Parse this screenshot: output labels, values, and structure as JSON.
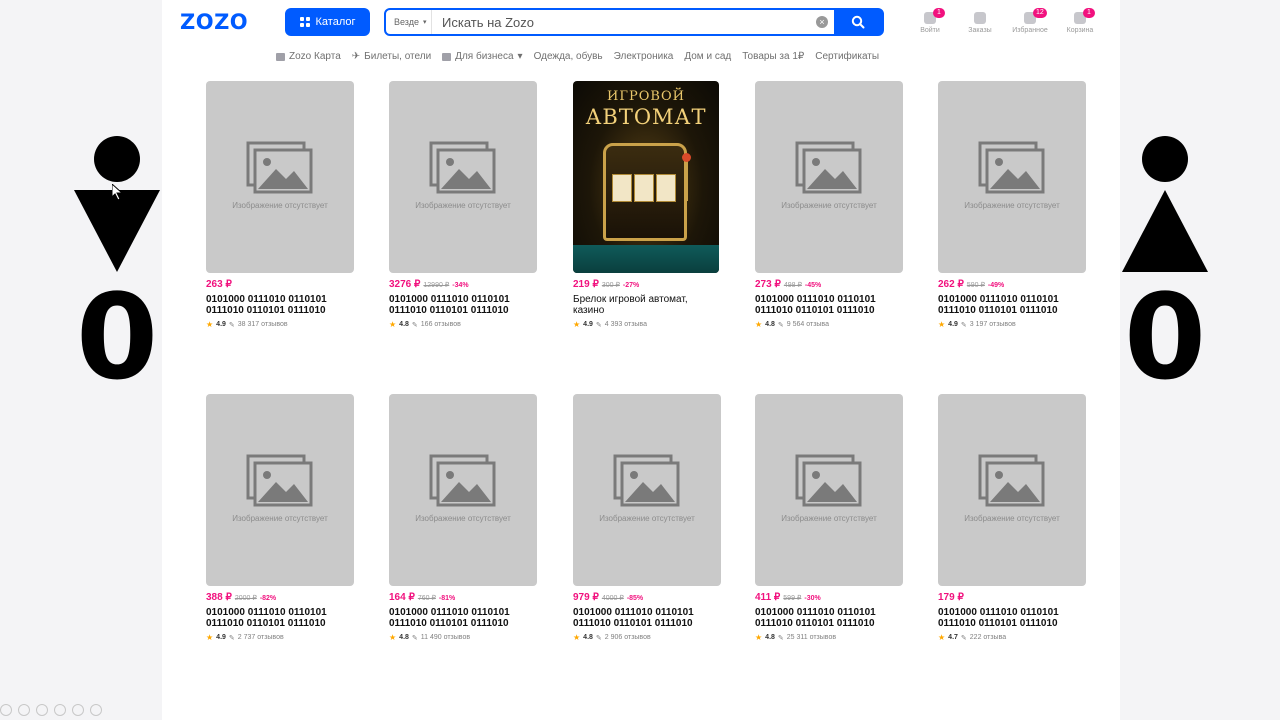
{
  "header": {
    "logo": "ZOZO",
    "catalog_label": "Каталог",
    "search": {
      "scope": "Везде",
      "placeholder": "Искать на Zozo"
    },
    "icons": [
      {
        "icon": "profile-icon",
        "label": "Войти",
        "badge": "1"
      },
      {
        "icon": "orders-icon",
        "label": "Заказы",
        "badge": ""
      },
      {
        "icon": "favorites-icon",
        "label": "Избранное",
        "badge": "12"
      },
      {
        "icon": "cart-icon",
        "label": "Корзина",
        "badge": "1"
      }
    ]
  },
  "nav": [
    {
      "label": "Zozo Карта",
      "icon": "card-icon"
    },
    {
      "label": "Билеты, отели",
      "icon": "plane-icon"
    },
    {
      "label": "Для бизнеса",
      "icon": "briefcase-icon",
      "dropdown": true
    },
    {
      "label": "Одежда, обувь"
    },
    {
      "label": "Электроника"
    },
    {
      "label": "Дом и сад"
    },
    {
      "label": "Товары за 1₽"
    },
    {
      "label": "Сертификаты"
    }
  ],
  "no_image_text": "Изображение отсутствует",
  "products": [
    {
      "price": "263 ₽",
      "old": "",
      "discount": "",
      "title": "0101000 0111010 0110101 0111010 0110101 0111010",
      "rating": "4.9",
      "reviews": "38 317 отзывов",
      "has_image": false
    },
    {
      "price": "3276 ₽",
      "old": "12990 ₽",
      "discount": "-34%",
      "title": "0101000 0111010 0110101 0111010 0110101 0111010",
      "rating": "4.8",
      "reviews": "166 отзывов",
      "has_image": false
    },
    {
      "price": "219 ₽",
      "old": "300 ₽",
      "discount": "-27%",
      "title": "Брелок игровой автомат, казино",
      "rating": "4.9",
      "reviews": "4 393 отзыва",
      "has_image": true,
      "poster": {
        "line1": "ИГРОВОЙ",
        "line2": "АВТОМАТ"
      }
    },
    {
      "price": "273 ₽",
      "old": "498 ₽",
      "discount": "-45%",
      "title": "0101000 0111010 0110101 0111010 0110101 0111010",
      "rating": "4.8",
      "reviews": "9 564 отзыва",
      "has_image": false
    },
    {
      "price": "262 ₽",
      "old": "590 ₽",
      "discount": "-49%",
      "title": "0101000 0111010 0110101 0111010 0110101 0111010",
      "rating": "4.9",
      "reviews": "3 197 отзывов",
      "has_image": false
    },
    {
      "price": "388 ₽",
      "old": "2000 ₽",
      "discount": "-82%",
      "title": "0101000 0111010 0110101 0111010 0110101 0111010",
      "rating": "4.9",
      "reviews": "2 737 отзывов",
      "has_image": false
    },
    {
      "price": "164 ₽",
      "old": "760 ₽",
      "discount": "-81%",
      "title": "0101000 0111010 0110101 0111010 0110101 0111010",
      "rating": "4.8",
      "reviews": "11 490 отзывов",
      "has_image": false
    },
    {
      "price": "979 ₽",
      "old": "4000 ₽",
      "discount": "-85%",
      "title": "0101000 0111010 0110101 0111010 0110101 0111010",
      "rating": "4.8",
      "reviews": "2 906 отзывов",
      "has_image": false
    },
    {
      "price": "411 ₽",
      "old": "599 ₽",
      "discount": "-30%",
      "title": "0101000 0111010 0110101 0111010 0110101 0111010",
      "rating": "4.8",
      "reviews": "25 311 отзывов",
      "has_image": false
    },
    {
      "price": "179 ₽",
      "old": "",
      "discount": "",
      "title": "0101000 0111010 0110101 0111010 0110101 0111010",
      "rating": "4.7",
      "reviews": "222 отзыва",
      "has_image": false
    }
  ],
  "side": {
    "left": {
      "counter": "0",
      "shape": "triangle-down"
    },
    "right": {
      "counter": "0",
      "shape": "triangle-up"
    }
  }
}
